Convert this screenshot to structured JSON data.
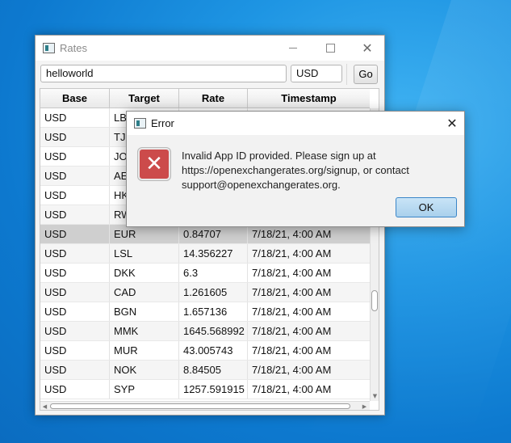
{
  "window": {
    "title": "Rates",
    "search_value": "helloworld",
    "currency_value": "USD",
    "go_label": "Go"
  },
  "table": {
    "columns": [
      "Base",
      "Target",
      "Rate",
      "Timestamp"
    ],
    "rows": [
      {
        "base": "USD",
        "target": "LBP",
        "rate": "",
        "timestamp": ""
      },
      {
        "base": "USD",
        "target": "TJS",
        "rate": "",
        "timestamp": ""
      },
      {
        "base": "USD",
        "target": "JOD",
        "rate": "",
        "timestamp": ""
      },
      {
        "base": "USD",
        "target": "AED",
        "rate": "",
        "timestamp": ""
      },
      {
        "base": "USD",
        "target": "HKD",
        "rate": "",
        "timestamp": ""
      },
      {
        "base": "USD",
        "target": "RWF",
        "rate": "",
        "timestamp": ""
      },
      {
        "base": "USD",
        "target": "EUR",
        "rate": "0.84707",
        "timestamp": "7/18/21, 4:00 AM"
      },
      {
        "base": "USD",
        "target": "LSL",
        "rate": "14.356227",
        "timestamp": "7/18/21, 4:00 AM"
      },
      {
        "base": "USD",
        "target": "DKK",
        "rate": "6.3",
        "timestamp": "7/18/21, 4:00 AM"
      },
      {
        "base": "USD",
        "target": "CAD",
        "rate": "1.261605",
        "timestamp": "7/18/21, 4:00 AM"
      },
      {
        "base": "USD",
        "target": "BGN",
        "rate": "1.657136",
        "timestamp": "7/18/21, 4:00 AM"
      },
      {
        "base": "USD",
        "target": "MMK",
        "rate": "1645.568992",
        "timestamp": "7/18/21, 4:00 AM"
      },
      {
        "base": "USD",
        "target": "MUR",
        "rate": "43.005743",
        "timestamp": "7/18/21, 4:00 AM"
      },
      {
        "base": "USD",
        "target": "NOK",
        "rate": "8.84505",
        "timestamp": "7/18/21, 4:00 AM"
      },
      {
        "base": "USD",
        "target": "SYP",
        "rate": "1257.591915",
        "timestamp": "7/18/21, 4:00 AM"
      }
    ],
    "selected_target": "EUR"
  },
  "dialog": {
    "title": "Error",
    "message_lines": [
      "Invalid App ID provided. Please sign up at",
      "https://openexchangerates.org/signup, or contact",
      "support@openexchangerates.org."
    ],
    "ok_label": "OK"
  },
  "icons": {
    "app": "app-window-icon",
    "error": "error-x-icon",
    "close": "close-icon",
    "minimize": "minimize-icon",
    "maximize": "maximize-icon"
  },
  "colors": {
    "desktop": "#1e95e3",
    "selected_row": "#cfcfcf",
    "error_icon": "#cc4b4b",
    "default_button": "#a9d0ec"
  }
}
